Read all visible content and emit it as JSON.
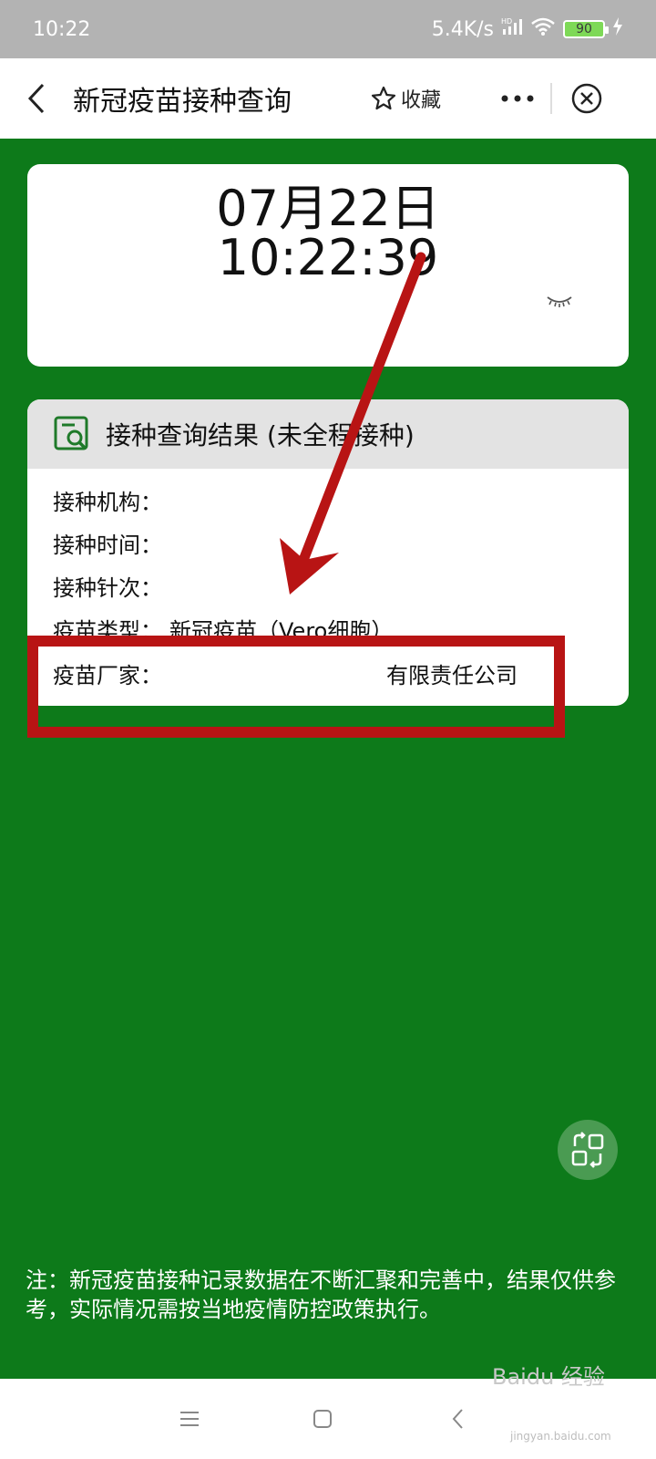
{
  "status_bar": {
    "time": "10:22",
    "network_speed": "5.4K/s",
    "hd_badge": "HD",
    "battery": "90",
    "icons": [
      "signal-icon",
      "wifi-icon",
      "battery-icon",
      "charging-icon"
    ]
  },
  "header": {
    "title": "新冠疫苗接种查询",
    "favorite_label": "收藏",
    "icons": [
      "back-icon",
      "star-icon",
      "more-icon",
      "close-icon"
    ]
  },
  "time_card": {
    "date": "07月22日",
    "time": "10:22:39"
  },
  "result_card": {
    "title": "接种查询结果 (未全程接种)",
    "fields": [
      {
        "label": "接种机构：",
        "value": ""
      },
      {
        "label": "接种时间：",
        "value": ""
      },
      {
        "label": "接种针次：",
        "value": ""
      },
      {
        "label": "疫苗类型：",
        "value": "新冠疫苗（Vero细胞）"
      },
      {
        "label": "疫苗厂家：",
        "value": "有限责任公司"
      }
    ]
  },
  "note": "注：新冠疫苗接种记录数据在不断汇聚和完善中，结果仅供参考，实际情况需按当地疫情防控政策执行。",
  "watermark": {
    "text": "Baidu 经验",
    "sub": "jingyan.baidu.com"
  },
  "colors": {
    "background_green": "#0d7a1a",
    "highlight_red": "#b81414",
    "status_bar_gray": "#b3b3b3"
  }
}
